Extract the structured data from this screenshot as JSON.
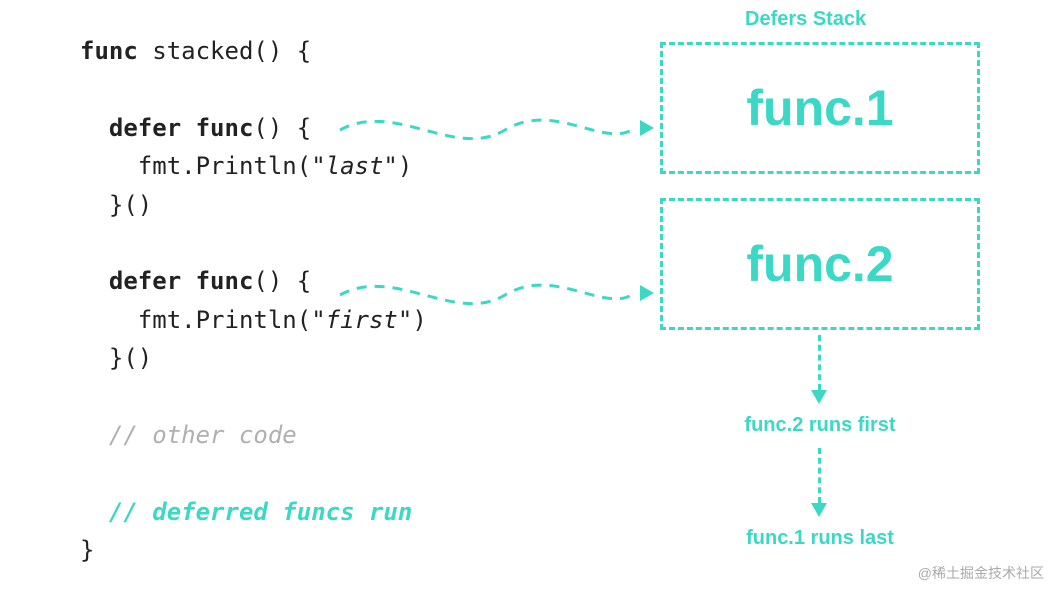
{
  "code": {
    "funcDecl_kw": "func",
    "funcDecl_name": " stacked() {",
    "defer1_kw": "defer func",
    "defer1_paren": "() {",
    "defer1_body_pre": "    fmt.Println(",
    "defer1_body_str": "\"last\"",
    "defer1_body_post": ")",
    "defer1_close": "  }()",
    "defer2_kw": "defer func",
    "defer2_paren": "() {",
    "defer2_body_pre": "    fmt.Println(",
    "defer2_body_str": "\"first\"",
    "defer2_body_post": ")",
    "defer2_close": "  }()",
    "comment_other": "  // other code",
    "comment_run": "  // deferred funcs run",
    "close": "}"
  },
  "stack": {
    "title": "Defers Stack",
    "item1": "func.1",
    "item2": "func.2"
  },
  "exec": {
    "first": "func.2 runs first",
    "last": "func.1 runs last"
  },
  "watermark": "@稀土掘金技术社区"
}
